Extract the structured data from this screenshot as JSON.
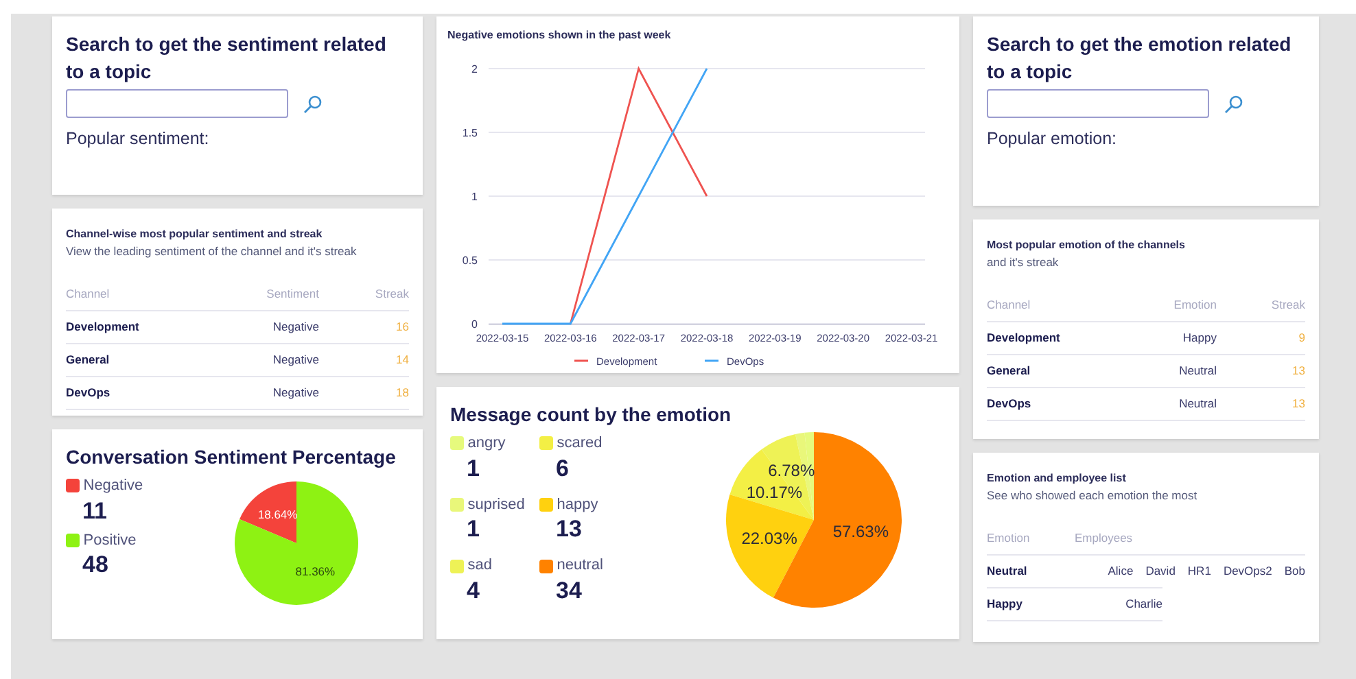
{
  "sentiment_search": {
    "title": "Search to get the sentiment related to a topic",
    "result_label": "Popular sentiment:"
  },
  "channel_sentiment": {
    "title": "Channel-wise most popular sentiment and streak",
    "subtitle": "View the leading sentiment of the channel and it's streak",
    "columns": [
      "Channel",
      "Sentiment",
      "Streak"
    ],
    "rows": [
      [
        "Development",
        "Negative",
        "16"
      ],
      [
        "General",
        "Negative",
        "14"
      ],
      [
        "DevOps",
        "Negative",
        "18"
      ]
    ]
  },
  "sentiment_percentage": {
    "title": "Conversation Sentiment Percentage",
    "items": [
      {
        "count": "11",
        "color": "#f4433b"
      },
      {
        "count": "48",
        "color": "#8ef213"
      }
    ],
    "chart_data": {
      "type": "pie",
      "categories": [
        "Negative",
        "Positive"
      ],
      "values": [
        18.64,
        81.36
      ],
      "value_labels": [
        "18.64%",
        "81.36%"
      ]
    }
  },
  "negative_emotions": {
    "chart_data": {
      "type": "line",
      "title": "Negative emotions shown in the past week",
      "categories": [
        "2022-03-15",
        "2022-03-16",
        "2022-03-17",
        "2022-03-18",
        "2022-03-19",
        "2022-03-20",
        "2022-03-21"
      ],
      "ylim": [
        0,
        2
      ],
      "yticks": [
        {
          "value": 0,
          "label": "0"
        },
        {
          "value": 0.5,
          "label": "0.5"
        },
        {
          "value": 1,
          "label": "1"
        },
        {
          "value": 1.5,
          "label": "1.5"
        },
        {
          "value": 2,
          "label": "2"
        }
      ],
      "grid": true,
      "legend": "bottom",
      "series": [
        {
          "name": "Development",
          "color": "#ef5350",
          "values": [
            null,
            0,
            2,
            1,
            null,
            null,
            null
          ]
        },
        {
          "name": "DevOps",
          "color": "#42a5f5",
          "values": [
            0,
            0,
            1,
            2,
            null,
            null,
            null
          ]
        }
      ]
    }
  },
  "emotion_count": {
    "title": "Message count by the emotion",
    "items": [
      {
        "count": "1",
        "color": "#e6fa7d"
      },
      {
        "count": "1",
        "color": "#e9f77a"
      },
      {
        "count": "4",
        "color": "#eef256"
      },
      {
        "count": "6",
        "color": "#f3ef45"
      },
      {
        "count": "13",
        "color": "#ffd10f"
      },
      {
        "count": "34",
        "color": "#ff8200"
      }
    ],
    "chart_data": {
      "type": "pie",
      "categories": [
        "angry",
        "suprised",
        "sad",
        "scared",
        "happy",
        "neutral"
      ],
      "values": [
        1.69,
        1.69,
        6.78,
        10.17,
        22.03,
        57.63
      ],
      "value_labels": [
        null,
        null,
        "6.78%",
        "10.17%",
        "22.03%",
        "57.63%"
      ]
    }
  },
  "emotion_search": {
    "title": "Search to get the emotion related to a topic",
    "result_label": "Popular emotion:"
  },
  "channel_emotion": {
    "title": "Most popular emotion of the channels",
    "subtitle": "and it's streak",
    "columns": [
      "Channel",
      "Emotion",
      "Streak"
    ],
    "rows": [
      [
        "Development",
        "Happy",
        "9"
      ],
      [
        "General",
        "Neutral",
        "13"
      ],
      [
        "DevOps",
        "Neutral",
        "13"
      ]
    ]
  },
  "emotion_employees": {
    "title": "Emotion and employee list",
    "subtitle": "See who showed each emotion the most",
    "columns": [
      "Emotion",
      "Employees"
    ],
    "rows": [
      {
        "emotion": "Neutral",
        "employees": [
          "Alice",
          "David",
          "HR1",
          "DevOps2",
          "Bob"
        ]
      },
      {
        "emotion": "Happy",
        "employees": [
          "Charlie"
        ]
      }
    ]
  }
}
